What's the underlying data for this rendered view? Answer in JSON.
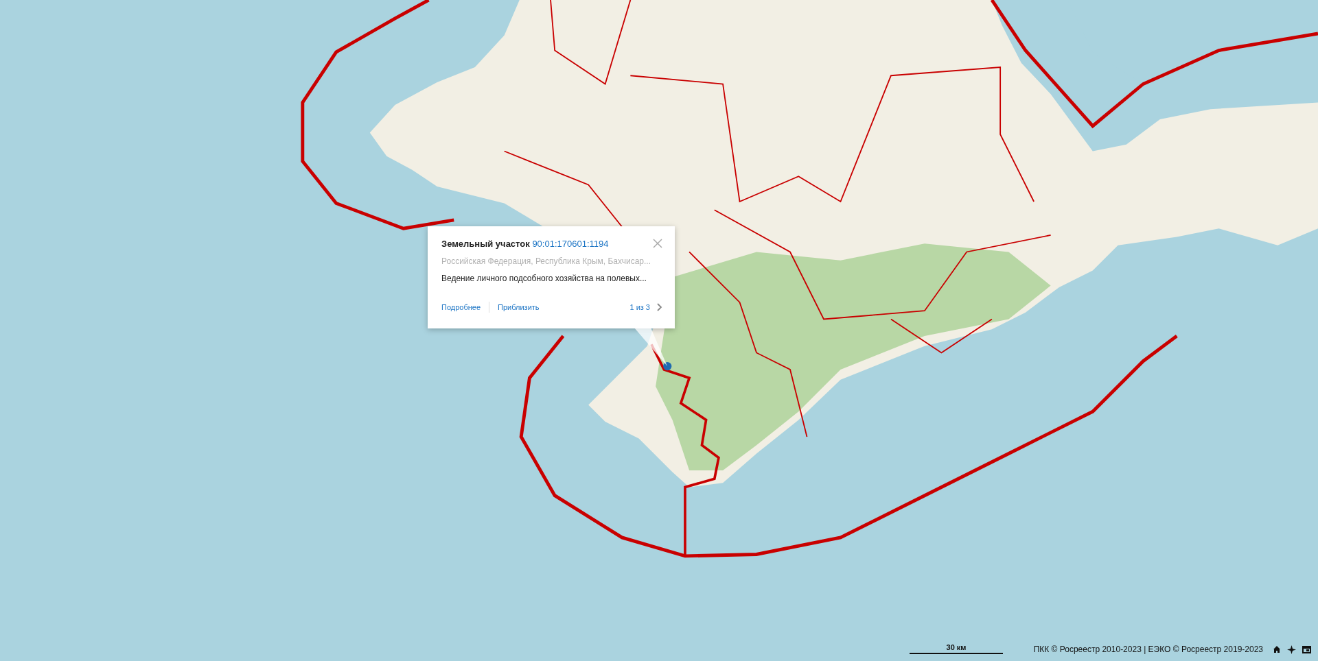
{
  "popup": {
    "title": "Земельный участок",
    "cadastral_number": "90:01:170601:1194",
    "address": "Российская Федерация, Республика Крым, Бахчисар...",
    "description": "Ведение личного подсобного хозяйства на полевых...",
    "links": [
      "Подробнее",
      "Приблизить"
    ],
    "pager": "1 из 3"
  },
  "scale_bar": {
    "label": "30 км"
  },
  "attribution": "ПКК © Росреестр 2010-2023 | ЕЭКО © Росреестр 2019-2023"
}
